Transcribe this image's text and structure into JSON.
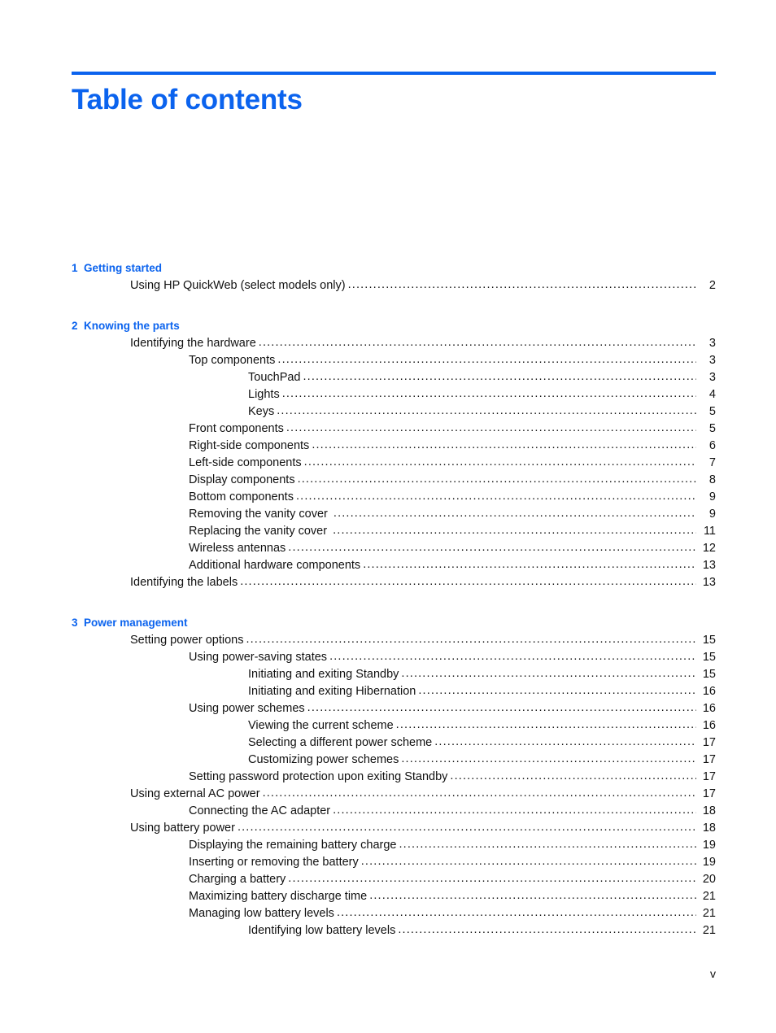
{
  "document": {
    "title": "Table of contents",
    "accent_color": "#0B63EE",
    "text_color": "#111111",
    "footer_page_number": "v",
    "leader_character": "."
  },
  "chapters": [
    {
      "number": "1",
      "name": "Getting started",
      "heading": "1  Getting started",
      "entries": [
        {
          "label": "Using HP QuickWeb (select models only)",
          "page": "2",
          "level": 1
        }
      ]
    },
    {
      "number": "2",
      "name": "Knowing the parts",
      "heading": "2  Knowing the parts",
      "entries": [
        {
          "label": "Identifying the hardware",
          "page": "3",
          "level": 1
        },
        {
          "label": "Top components",
          "page": "3",
          "level": 2
        },
        {
          "label": "TouchPad",
          "page": "3",
          "level": 3
        },
        {
          "label": "Lights",
          "page": "4",
          "level": 3
        },
        {
          "label": "Keys",
          "page": "5",
          "level": 3
        },
        {
          "label": "Front components",
          "page": "5",
          "level": 2
        },
        {
          "label": "Right-side components",
          "page": "6",
          "level": 2
        },
        {
          "label": "Left-side components",
          "page": "7",
          "level": 2
        },
        {
          "label": "Display components",
          "page": "8",
          "level": 2
        },
        {
          "label": "Bottom components",
          "page": "9",
          "level": 2
        },
        {
          "label": "Removing the vanity cover ",
          "page": "9",
          "level": 2
        },
        {
          "label": "Replacing the vanity cover ",
          "page": "11",
          "level": 2
        },
        {
          "label": "Wireless antennas",
          "page": "12",
          "level": 2
        },
        {
          "label": "Additional hardware components",
          "page": "13",
          "level": 2
        },
        {
          "label": "Identifying the labels",
          "page": "13",
          "level": 1
        }
      ]
    },
    {
      "number": "3",
      "name": "Power management",
      "heading": "3  Power management",
      "entries": [
        {
          "label": "Setting power options",
          "page": "15",
          "level": 1
        },
        {
          "label": "Using power-saving states",
          "page": "15",
          "level": 2
        },
        {
          "label": "Initiating and exiting Standby",
          "page": "15",
          "level": 3
        },
        {
          "label": "Initiating and exiting Hibernation",
          "page": "16",
          "level": 3
        },
        {
          "label": "Using power schemes",
          "page": "16",
          "level": 2
        },
        {
          "label": "Viewing the current scheme",
          "page": "16",
          "level": 3
        },
        {
          "label": "Selecting a different power scheme",
          "page": "17",
          "level": 3
        },
        {
          "label": "Customizing power schemes",
          "page": "17",
          "level": 3
        },
        {
          "label": "Setting password protection upon exiting Standby",
          "page": "17",
          "level": 2
        },
        {
          "label": "Using external AC power",
          "page": "17",
          "level": 1
        },
        {
          "label": "Connecting the AC adapter",
          "page": "18",
          "level": 2
        },
        {
          "label": "Using battery power",
          "page": "18",
          "level": 1
        },
        {
          "label": "Displaying the remaining battery charge",
          "page": "19",
          "level": 2
        },
        {
          "label": "Inserting or removing the battery",
          "page": "19",
          "level": 2
        },
        {
          "label": "Charging a battery",
          "page": "20",
          "level": 2
        },
        {
          "label": "Maximizing battery discharge time",
          "page": "21",
          "level": 2
        },
        {
          "label": "Managing low battery levels",
          "page": "21",
          "level": 2
        },
        {
          "label": "Identifying low battery levels",
          "page": "21",
          "level": 3
        }
      ]
    }
  ]
}
